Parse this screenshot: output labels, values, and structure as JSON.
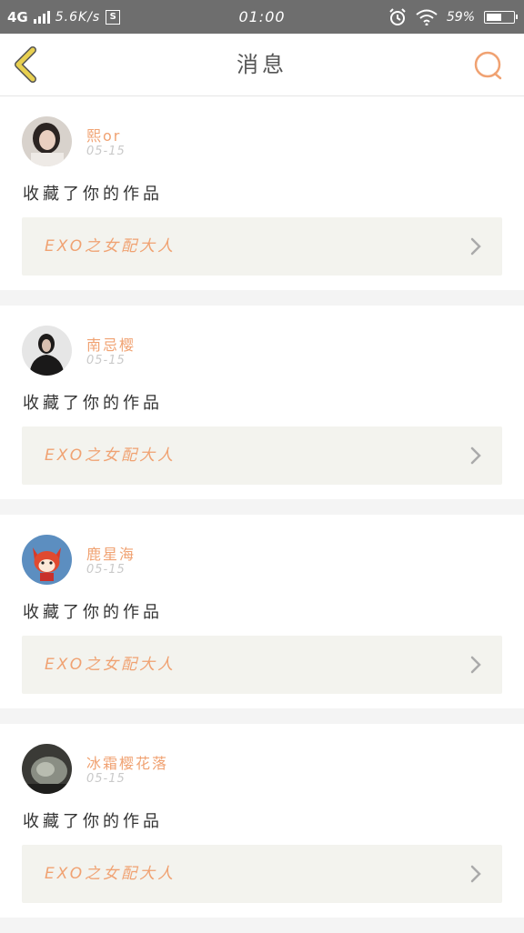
{
  "status_bar": {
    "network": "4G",
    "speed": "5.6K/s",
    "s_icon": "S",
    "time": "01:00",
    "battery": "59%",
    "battery_level": 0.59,
    "icons": [
      "signal-icon",
      "s-app-icon",
      "alarm-icon",
      "wifi-icon",
      "battery-icon"
    ]
  },
  "header": {
    "title": "消息",
    "back_icon": "chevron-left-icon",
    "search_icon": "search-icon"
  },
  "colors": {
    "accent": "#f0a272",
    "back_icon": "#e8d050",
    "work_box_bg": "#f3f3ee",
    "separator_bg": "#f4f4f4"
  },
  "messages": [
    {
      "username": "熙or",
      "date": "05-15",
      "action": "收藏了你的作品",
      "work_title": "EXO之女配大人"
    },
    {
      "username": "南忌樱",
      "date": "05-15",
      "action": "收藏了你的作品",
      "work_title": "EXO之女配大人"
    },
    {
      "username": "鹿星海",
      "date": "05-15",
      "action": "收藏了你的作品",
      "work_title": "EXO之女配大人"
    },
    {
      "username": "冰霜樱花落",
      "date": "05-15",
      "action": "收藏了你的作品",
      "work_title": "EXO之女配大人"
    }
  ]
}
